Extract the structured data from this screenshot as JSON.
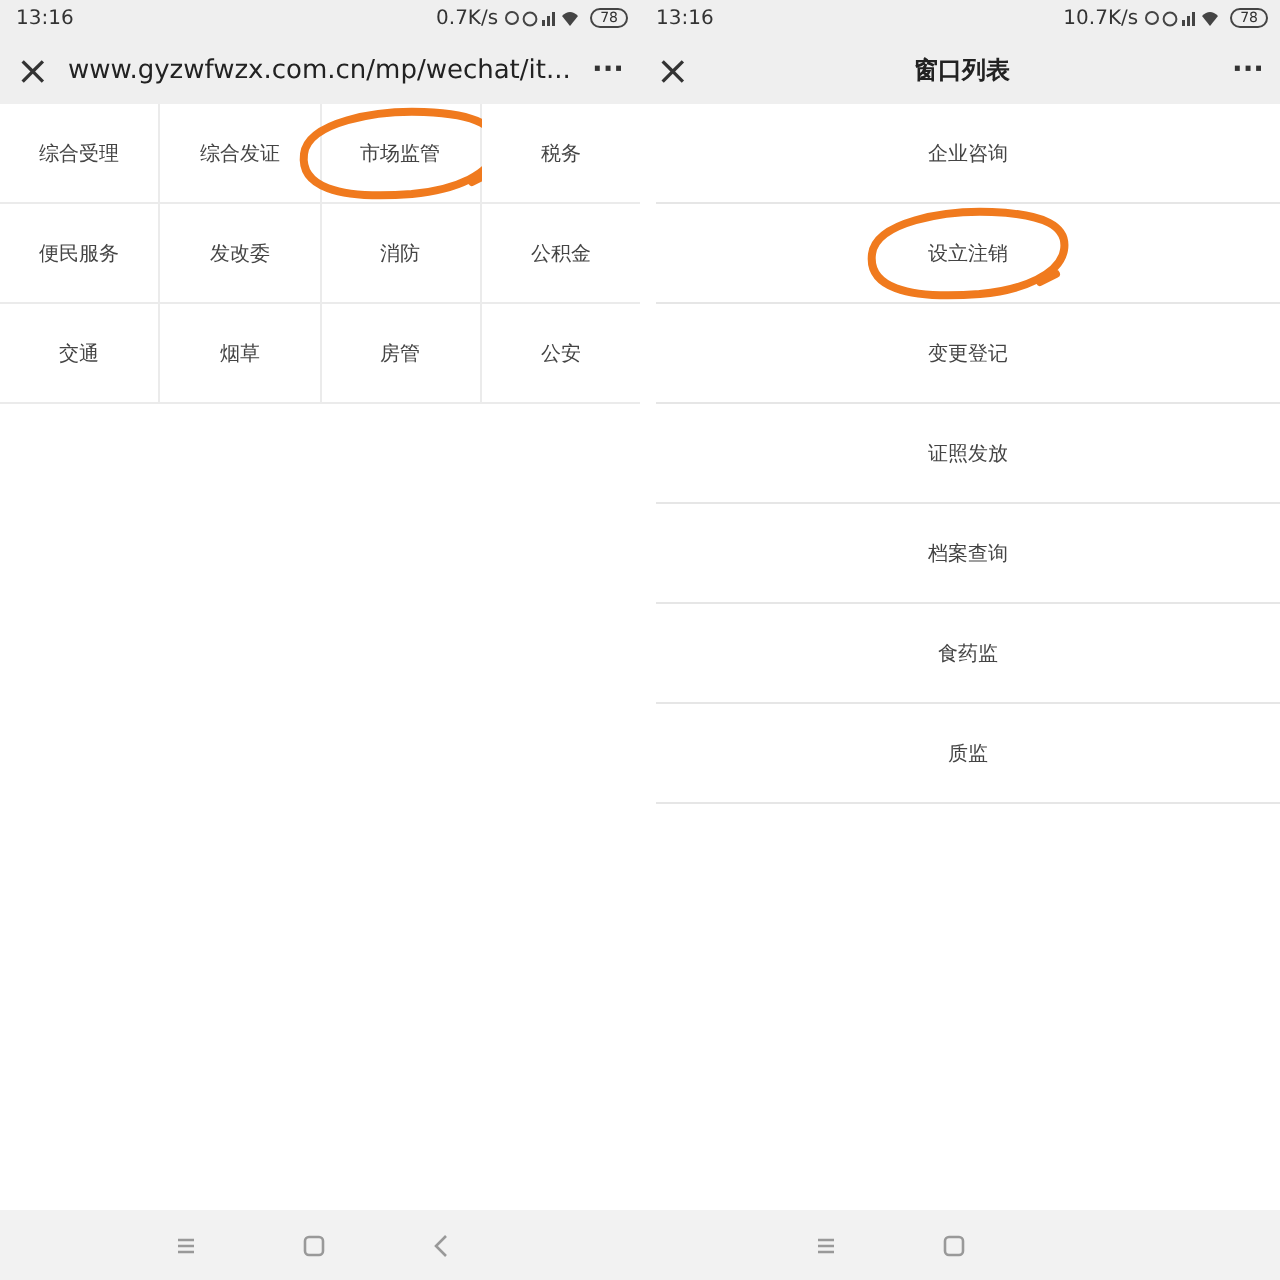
{
  "phones": [
    {
      "status_bar": {
        "time": "13:16",
        "speed": "0.7K/s",
        "battery": "78"
      },
      "title_bar": {
        "close": "×",
        "title": "www.gyzwfwzx.com.cn/mp/wechat/it...",
        "kind": "url",
        "more": "···"
      },
      "content": {
        "kind": "grid",
        "items": [
          {
            "label": "综合受理",
            "circled": false
          },
          {
            "label": "综合发证",
            "circled": false
          },
          {
            "label": "市场监管",
            "circled": true
          },
          {
            "label": "税务",
            "circled": false
          },
          {
            "label": "便民服务",
            "circled": false
          },
          {
            "label": "发改委",
            "circled": false
          },
          {
            "label": "消防",
            "circled": false
          },
          {
            "label": "公积金",
            "circled": false
          },
          {
            "label": "交通",
            "circled": false
          },
          {
            "label": "烟草",
            "circled": false
          },
          {
            "label": "房管",
            "circled": false
          },
          {
            "label": "公安",
            "circled": false
          }
        ]
      },
      "nav_bar": [
        {
          "kind": "menu"
        },
        {
          "kind": "home"
        },
        {
          "kind": "back"
        }
      ]
    },
    {
      "status_bar": {
        "time": "13:16",
        "speed": "10.7K/s",
        "battery": "78"
      },
      "title_bar": {
        "close": "×",
        "title": "窗口列表",
        "kind": "heading",
        "more": "···"
      },
      "content": {
        "kind": "list",
        "items": [
          {
            "label": "企业咨询",
            "circled": false
          },
          {
            "label": "设立注销",
            "circled": true
          },
          {
            "label": "变更登记",
            "circled": false
          },
          {
            "label": "证照发放",
            "circled": false
          },
          {
            "label": "档案查询",
            "circled": false
          },
          {
            "label": "食药监",
            "circled": false
          },
          {
            "label": "质监",
            "circled": false
          }
        ]
      },
      "nav_bar": [
        {
          "kind": "menu"
        },
        {
          "kind": "home"
        }
      ]
    }
  ]
}
